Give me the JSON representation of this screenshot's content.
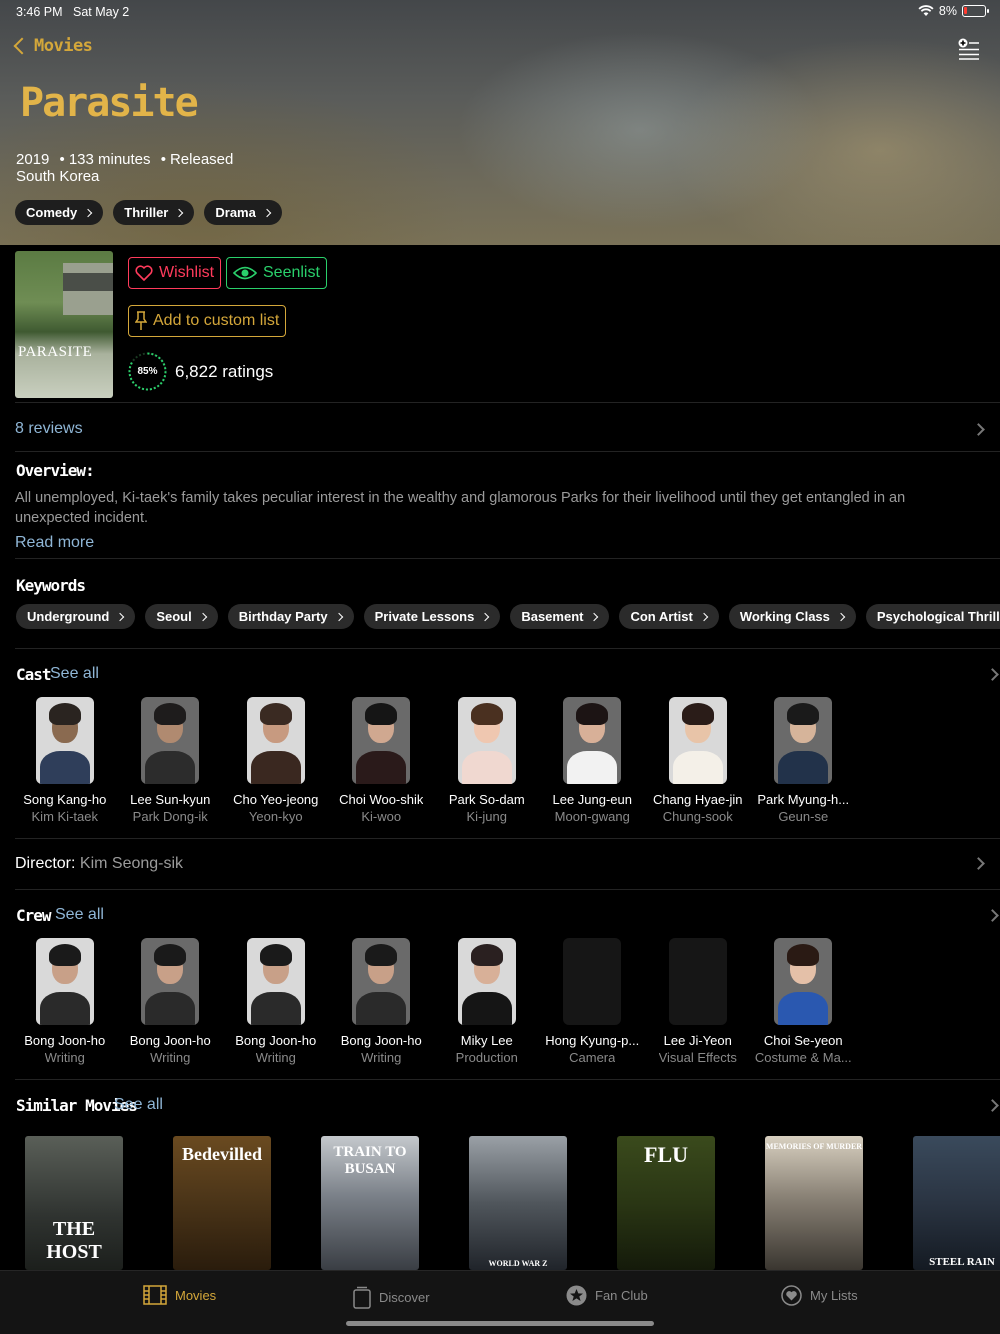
{
  "status": {
    "time": "3:46 PM",
    "date": "Sat May 2",
    "battery": "8%"
  },
  "nav": {
    "back_label": "Movies"
  },
  "movie": {
    "title": "Parasite",
    "year": "2019",
    "runtime": "133 minutes",
    "status": "Released",
    "country": "South Korea",
    "genres": [
      "Comedy",
      "Thriller",
      "Drama"
    ],
    "poster_title": "PARASITE"
  },
  "actions": {
    "wishlist": "Wishlist",
    "seenlist": "Seenlist",
    "custom_list": "Add to custom list",
    "score": "85%",
    "score_fraction": 0.85,
    "ratings": "6,822 ratings",
    "reviews": "8 reviews"
  },
  "overview": {
    "heading": "Overview:",
    "text": "All unemployed, Ki-taek's family takes peculiar interest in the wealthy and glamorous Parks for their livelihood until they get entangled in an unexpected incident.",
    "read_more": "Read more"
  },
  "keywords": {
    "heading": "Keywords",
    "items": [
      "Underground",
      "Seoul",
      "Birthday Party",
      "Private Lessons",
      "Basement",
      "Con Artist",
      "Working Class",
      "Psychological Thriller"
    ]
  },
  "cast": {
    "heading": "Cast",
    "see_all": "See all",
    "people": [
      {
        "name": "Song Kang-ho",
        "role": "Kim Ki-taek"
      },
      {
        "name": "Lee Sun-kyun",
        "role": "Park Dong-ik"
      },
      {
        "name": "Cho Yeo-jeong",
        "role": "Yeon-kyo"
      },
      {
        "name": "Choi Woo-shik",
        "role": "Ki-woo"
      },
      {
        "name": "Park So-dam",
        "role": "Ki-jung"
      },
      {
        "name": "Lee Jung-eun",
        "role": "Moon-gwang"
      },
      {
        "name": "Chang Hyae-jin",
        "role": "Chung-sook"
      },
      {
        "name": "Park Myung-h...",
        "role": "Geun-se"
      }
    ]
  },
  "director": {
    "label": "Director:",
    "name": "Kim Seong-sik"
  },
  "crew": {
    "heading": "Crew",
    "see_all": "See all",
    "people": [
      {
        "name": "Bong Joon-ho",
        "role": "Writing"
      },
      {
        "name": "Bong Joon-ho",
        "role": "Writing"
      },
      {
        "name": "Bong Joon-ho",
        "role": "Writing"
      },
      {
        "name": "Bong Joon-ho",
        "role": "Writing"
      },
      {
        "name": "Miky Lee",
        "role": "Production"
      },
      {
        "name": "Hong Kyung-p...",
        "role": "Camera"
      },
      {
        "name": "Lee Ji-Yeon",
        "role": "Visual Effects"
      },
      {
        "name": "Choi Se-yeon",
        "role": "Costume & Ma..."
      }
    ]
  },
  "similar": {
    "heading": "Similar Movies",
    "see_all": "See all",
    "posters": [
      {
        "label": "THE HOST"
      },
      {
        "label": "Bedevilled"
      },
      {
        "label": "TRAIN TO BUSAN"
      },
      {
        "label": "WORLD WAR Z"
      },
      {
        "label": "FLU"
      },
      {
        "label": "MEMORIES OF MURDER"
      },
      {
        "label": "STEEL RAIN"
      }
    ]
  },
  "tabs": [
    {
      "label": "Movies",
      "icon": "film-icon",
      "active": true
    },
    {
      "label": "Discover",
      "icon": "discover-icon",
      "active": false
    },
    {
      "label": "Fan Club",
      "icon": "star-icon",
      "active": false
    },
    {
      "label": "My Lists",
      "icon": "heart-icon",
      "active": false
    }
  ],
  "colors": {
    "accent": "#d4a73a",
    "wishlist": "#ff3b5c",
    "seenlist": "#2ad06b",
    "link": "#8fb6d6"
  }
}
